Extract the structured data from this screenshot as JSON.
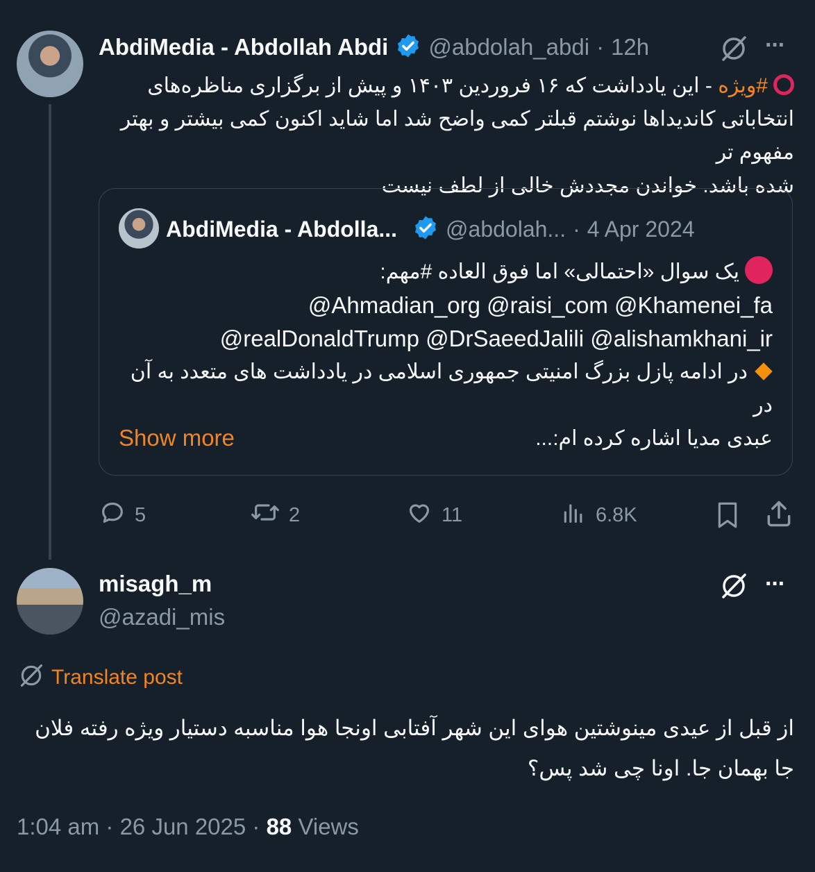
{
  "main_post": {
    "author_name": "AbdiMedia - Abdollah Abdi",
    "handle": "@abdolah_abdi",
    "separator": "·",
    "time": "12h",
    "more": "···",
    "text_hashtag": "#ویژه",
    "text_line1": "- این یادداشت که ۱۶ فروردین ۱۴۰۳ و پیش از برگزاری مناظره‌های",
    "text_line2": "انتخاباتی کاندیداها نوشتم قبلتر کمی واضح شد اما شاید اکنون کمی بیشتر و بهتر مفهوم تر",
    "text_line3": "شده باشد. خواندن مجددش خالی از لطف نیست"
  },
  "quoted_post": {
    "author_name": "AbdiMedia - Abdolla...",
    "handle": "@abdolah...",
    "separator": "·",
    "date": "4 Apr 2024",
    "line1": "یک سوال «احتمالی» اما فوق العاده #مهم:",
    "line2": "@Ahmadian_org @raisi_com @Khamenei_fa",
    "line3": "@realDonaldTrump @DrSaeedJalili @alishamkhani_ir",
    "line4": "در ادامه پازل بزرگ امنیتی جمهوری اسلامی در یادداشت های متعدد به آن در",
    "line5": "عبدی مدیا اشاره کرده ام:...",
    "show_more": "Show more"
  },
  "actions": {
    "replies": "5",
    "reposts": "2",
    "likes": "11",
    "views": "6.8K"
  },
  "reply_post": {
    "author_name": "misagh_m",
    "handle": "@azadi_mis",
    "more": "···",
    "translate": "Translate post",
    "text_line1": "از قبل از عیدی مینوشتین هوای این شهر آفتابی اونجا هوا مناسبه دستیار ویژه رفته فلان",
    "text_line2": "جا بهمان جا. اونا چی شد پس؟",
    "timestamp": "1:04 am · 26 Jun 2025 ·",
    "views_count": "88",
    "views_label": "Views"
  },
  "colors": {
    "background": "#15202b",
    "text": "#f7f9f9",
    "muted": "#8b98a5",
    "accent": "#f4841f",
    "verified": "#1d9bf0",
    "border": "#38444d"
  },
  "icons": [
    "grok-icon",
    "more-icon",
    "verified-badge-icon",
    "red-circle-icon",
    "orange-diamond-icon",
    "reply-icon",
    "repost-icon",
    "like-icon",
    "views-icon",
    "bookmark-icon",
    "share-icon",
    "translate-icon"
  ]
}
